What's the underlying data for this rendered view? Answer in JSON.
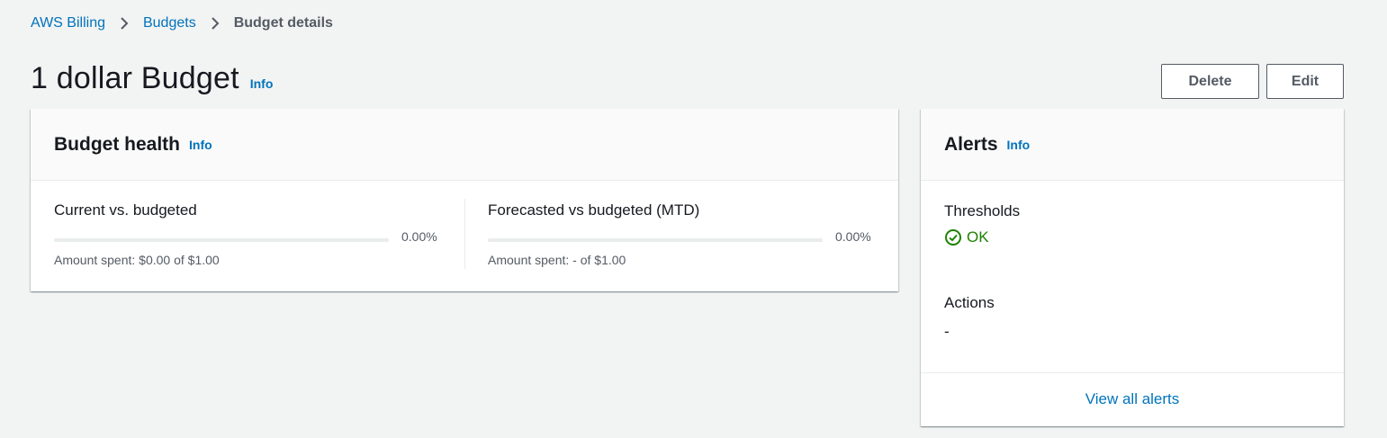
{
  "breadcrumb": {
    "items": [
      "AWS Billing",
      "Budgets"
    ],
    "current": "Budget details"
  },
  "page": {
    "title": "1 dollar Budget",
    "info": "Info"
  },
  "buttons": {
    "delete": "Delete",
    "edit": "Edit"
  },
  "budget_health": {
    "title": "Budget health",
    "info": "Info",
    "current": {
      "label": "Current vs. budgeted",
      "percent": "0.00%",
      "progress": 0,
      "amount": "Amount spent: $0.00 of $1.00"
    },
    "forecast": {
      "label": "Forecasted vs budgeted (MTD)",
      "percent": "0.00%",
      "progress": 0,
      "amount": "Amount spent: - of $1.00"
    }
  },
  "alerts": {
    "title": "Alerts",
    "info": "Info",
    "thresholds_label": "Thresholds",
    "thresholds_status": "OK",
    "actions_label": "Actions",
    "actions_value": "-",
    "view_all": "View all alerts"
  },
  "colors": {
    "link": "#0073bb",
    "success": "#1d8102",
    "background": "#f2f3f3"
  },
  "icons": {
    "separator": "chevron-right-icon",
    "status": "status-positive-icon"
  }
}
